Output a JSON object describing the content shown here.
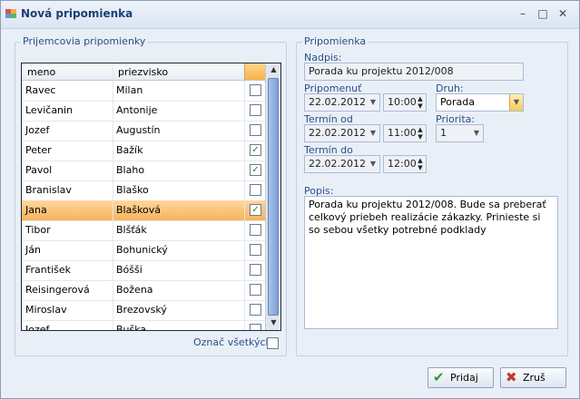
{
  "window": {
    "title": "Nová pripomienka",
    "minimize": "–",
    "maximize": "□",
    "close": "✕"
  },
  "recipients": {
    "group_title": "Prijemcovia pripomienky",
    "columns": {
      "name": "meno",
      "surname": "priezvisko"
    },
    "rows": [
      {
        "name": "Ravec",
        "surname": "Milan",
        "checked": false,
        "selected": false
      },
      {
        "name": "Levičanin",
        "surname": "Antonije",
        "checked": false,
        "selected": false
      },
      {
        "name": "Jozef",
        "surname": "Augustín",
        "checked": false,
        "selected": false
      },
      {
        "name": "Peter",
        "surname": "Bažík",
        "checked": true,
        "selected": false
      },
      {
        "name": "Pavol",
        "surname": "Blaho",
        "checked": true,
        "selected": false
      },
      {
        "name": "Branislav",
        "surname": "Blaško",
        "checked": false,
        "selected": false
      },
      {
        "name": "Jana",
        "surname": "Blašková",
        "checked": true,
        "selected": true
      },
      {
        "name": "Tibor",
        "surname": "Blšťák",
        "checked": false,
        "selected": false
      },
      {
        "name": "Ján",
        "surname": "Bohunický",
        "checked": false,
        "selected": false
      },
      {
        "name": "František",
        "surname": "Bóšši",
        "checked": false,
        "selected": false
      },
      {
        "name": "Reisingerová",
        "surname": "Božena",
        "checked": false,
        "selected": false
      },
      {
        "name": "Miroslav",
        "surname": "Brezovský",
        "checked": false,
        "selected": false
      },
      {
        "name": "Jozef",
        "surname": "Buška",
        "checked": false,
        "selected": false
      }
    ],
    "select_all_label": "Označ všetkých"
  },
  "reminder": {
    "group_title": "Pripomienka",
    "subject_label": "Nadpis:",
    "subject_value": "Porada ku projektu 2012/008",
    "remind_label": "Pripomenuť",
    "remind_date": "22.02.2012",
    "remind_time": "10:00",
    "type_label": "Druh:",
    "type_value": "Porada",
    "from_label": "Termín od",
    "from_date": "22.02.2012",
    "from_time": "11:00",
    "priority_label": "Priorita:",
    "priority_value": "1",
    "to_label": "Termín do",
    "to_date": "22.02.2012",
    "to_time": "12:00",
    "description_label": "Popis:",
    "description_value": "Porada ku projektu 2012/008. Bude sa preberať celkový priebeh realizácie zákazky. Prinieste si so sebou všetky potrebné podklady"
  },
  "buttons": {
    "add": "Pridaj",
    "cancel": "Zruš"
  },
  "colors": {
    "accent": "#2b4f8a",
    "selection": "#f7b25b",
    "check_green": "#1a8a1a",
    "cancel_red": "#c0392b"
  }
}
